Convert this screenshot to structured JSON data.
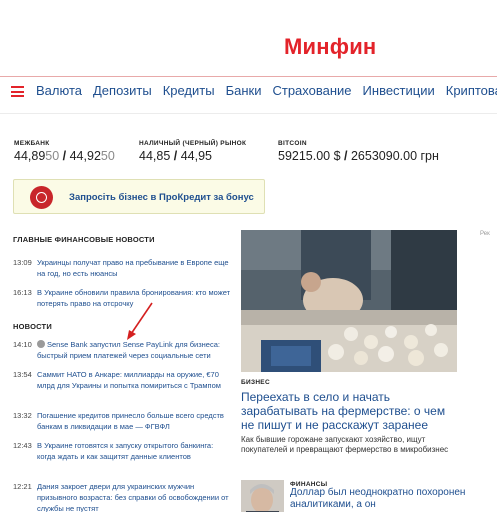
{
  "header": {
    "logo": "Минфин"
  },
  "nav": {
    "items": [
      "Валюта",
      "Депозиты",
      "Кредиты",
      "Банки",
      "Страхование",
      "Инвестиции",
      "Криптовалюты"
    ]
  },
  "rates": [
    {
      "label": "МЕЖБАНК",
      "buy": "44,8950",
      "sell": "44,9250",
      "buy_main": "44,89",
      "buy_small": "50",
      "sell_main": "44,92",
      "sell_small": "50"
    },
    {
      "label": "НАЛИЧНЫЙ (ЧЕРНЫЙ) РЫНОК",
      "buy": "44,85",
      "sell": "44,95"
    },
    {
      "label": "BITCOIN",
      "usd": "59215.00 $",
      "uah": "2653090.00 грн"
    }
  ],
  "banner": {
    "text": "Запросіть бізнес в ПроКредит за бонус"
  },
  "ad_label": "Рек",
  "main_news": {
    "heading": "ГЛАВНЫЕ ФИНАНСОВЫЕ НОВОСТИ",
    "items": [
      {
        "time": "13:09",
        "title": "Украинцы получат право на пребывание в Европе еще на год, но есть нюансы"
      },
      {
        "time": "16:13",
        "title": "В Украине обновили правила бронирования: кто может потерять право на отсрочку"
      }
    ]
  },
  "news": {
    "heading": "НОВОСТИ",
    "items": [
      {
        "time": "14:10",
        "title": "Sense Bank запустил Sense PayLink для бизнеса: быстрый прием платежей через социальные сети"
      },
      {
        "time": "13:54",
        "title": "Саммит НАТО в Анкаре: миллиарды на оружие, €70 млрд для Украины и попытка помириться с Трампом"
      },
      {
        "time": "13:32",
        "title": "Погашение кредитов принесло больше всего средств банкам в ликвидации в мае — ФГВФЛ"
      },
      {
        "time": "12:43",
        "title": "В Украине готовятся к запуску открытого банкинга: когда ждать и как защитят данные клиентов"
      },
      {
        "time": "12:21",
        "title": "Дания закроет двери для украинских мужчин призывного возраста: без справки об освобождении от службы не пустят"
      }
    ]
  },
  "featured": {
    "category": "БИЗНЕС",
    "title": "Переехать в село и начать зарабатывать на фермерстве: о чем не пишут и не расскажут заранее",
    "lead": "Как бывшие горожане запускают хозяйство, ищут покупателей и превращают фермерство в микробизнес"
  },
  "secondary": {
    "category": "ФИНАНСЫ",
    "title": "Доллар был неоднократно похоронен аналитиками, а он"
  },
  "colors": {
    "brand": "#e3232a",
    "link": "#1f4f8f"
  }
}
